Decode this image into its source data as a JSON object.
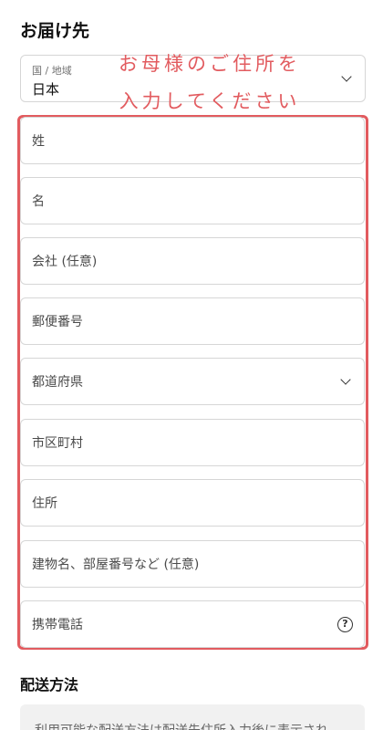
{
  "delivery": {
    "title": "お届け先",
    "country": {
      "label": "国 / 地域",
      "value": "日本"
    },
    "annotation": [
      "お母様のご住所を",
      "入力してください"
    ],
    "fields": {
      "last_name": "姓",
      "first_name": "名",
      "company": "会社 (任意)",
      "postal_code": "郵便番号",
      "prefecture": "都道府県",
      "city": "市区町村",
      "address": "住所",
      "building": "建物名、部屋番号など (任意)",
      "phone": "携帯電話"
    },
    "help_glyph": "?"
  },
  "shipping": {
    "title": "配送方法",
    "notice": "利用可能な配送方法は配送先住所入力後に表示され"
  },
  "colors": {
    "annotation": "#e25b5f",
    "border": "#d6d6d6"
  }
}
